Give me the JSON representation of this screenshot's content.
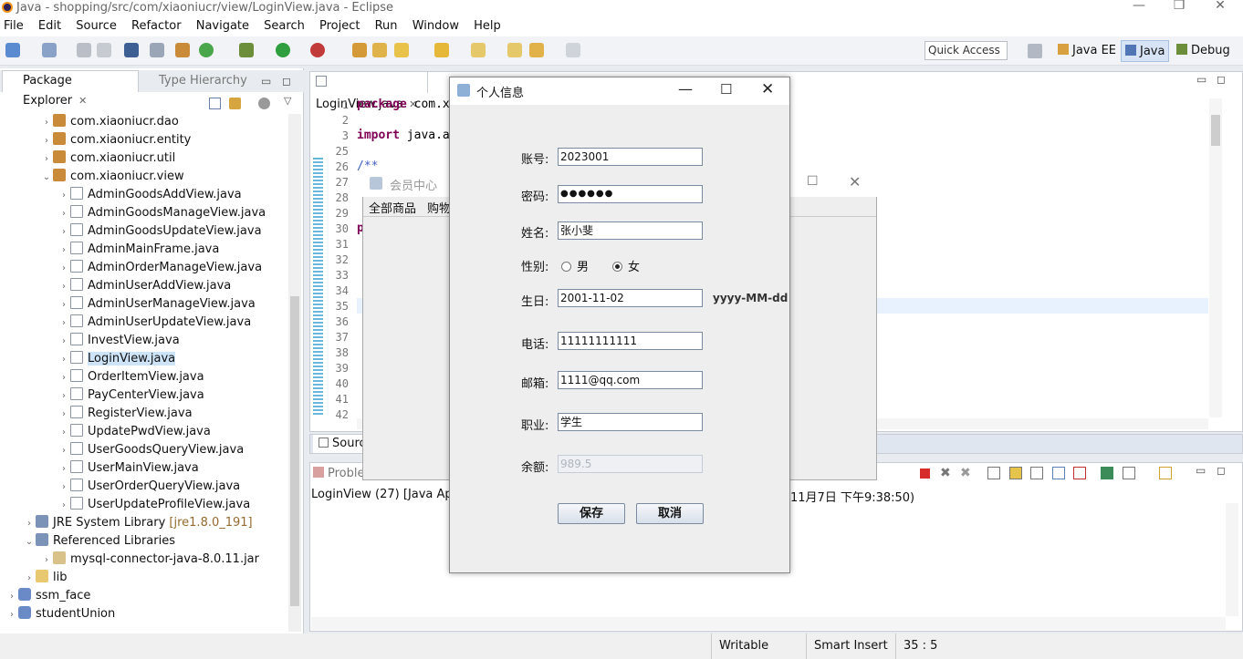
{
  "window": {
    "title": "Java - shopping/src/com/xiaoniucr/view/LoginView.java - Eclipse"
  },
  "menu": [
    "File",
    "Edit",
    "Source",
    "Refactor",
    "Navigate",
    "Search",
    "Project",
    "Run",
    "Window",
    "Help"
  ],
  "quick_access": "Quick Access",
  "perspectives": [
    "Java EE",
    "Java",
    "Debug"
  ],
  "package_explorer": {
    "tab_label": "Package Explorer",
    "tab2_label": "Type Hierarchy",
    "rows": [
      {
        "label": "com.xiaoniucr.dao",
        "extra": ""
      },
      {
        "label": "com.xiaoniucr.entity",
        "extra": ""
      },
      {
        "label": "com.xiaoniucr.util",
        "extra": ""
      },
      {
        "label": "com.xiaoniucr.view",
        "extra": ""
      },
      {
        "label": "AdminGoodsAddView.java",
        "extra": ""
      },
      {
        "label": "AdminGoodsManageView.java",
        "extra": ""
      },
      {
        "label": "AdminGoodsUpdateView.java",
        "extra": ""
      },
      {
        "label": "AdminMainFrame.java",
        "extra": ""
      },
      {
        "label": "AdminOrderManageView.java",
        "extra": ""
      },
      {
        "label": "AdminUserAddView.java",
        "extra": ""
      },
      {
        "label": "AdminUserManageView.java",
        "extra": ""
      },
      {
        "label": "AdminUserUpdateView.java",
        "extra": ""
      },
      {
        "label": "InvestView.java",
        "extra": ""
      },
      {
        "label": "LoginView.java",
        "extra": ""
      },
      {
        "label": "OrderItemView.java",
        "extra": ""
      },
      {
        "label": "PayCenterView.java",
        "extra": ""
      },
      {
        "label": "RegisterView.java",
        "extra": ""
      },
      {
        "label": "UpdatePwdView.java",
        "extra": ""
      },
      {
        "label": "UserGoodsQueryView.java",
        "extra": ""
      },
      {
        "label": "UserMainView.java",
        "extra": ""
      },
      {
        "label": "UserOrderQueryView.java",
        "extra": ""
      },
      {
        "label": "UserUpdateProfileView.java",
        "extra": ""
      },
      {
        "label": "JRE System Library",
        "extra": "[jre1.8.0_191]"
      },
      {
        "label": "Referenced Libraries",
        "extra": ""
      },
      {
        "label": "mysql-connector-java-8.0.11.jar",
        "extra": ""
      },
      {
        "label": "lib",
        "extra": ""
      },
      {
        "label": "ssm_face",
        "extra": ""
      },
      {
        "label": "studentUnion",
        "extra": ""
      }
    ]
  },
  "editor": {
    "tab_label": "LoginView.java",
    "line_numbers": [
      "1",
      "2",
      "3",
      "25",
      "26",
      "27",
      "28",
      "29",
      "30",
      "31",
      "32",
      "33",
      "34",
      "35",
      "36",
      "37",
      "38",
      "39",
      "40",
      "41",
      "42"
    ],
    "code_line1_kw": "package",
    "code_line1_rest": "com.x",
    "code_line3_kw": "import",
    "code_line3_rest": "java.a",
    "code_line26": "/**",
    "code_line30": "p",
    "source_tab": "Sourc"
  },
  "console": {
    "tab_label": "Proble",
    "line_left": "LoginView (27) [Java Appli",
    "line_right": "11月7日 下午9:38:50)"
  },
  "status": {
    "writable": "Writable",
    "insert": "Smart Insert",
    "position": "35 : 5"
  },
  "member_window": {
    "title": "会员中心",
    "menu1": "全部商品",
    "menu2": "购物"
  },
  "dialog": {
    "title": "个人信息",
    "account_label": "账号:",
    "account_value": "2023001",
    "password_label": "密码:",
    "password_value": "●●●●●●",
    "name_label": "姓名:",
    "name_value": "张小斐",
    "gender_label": "性别:",
    "gender_male": "男",
    "gender_female": "女",
    "birthday_label": "生日:",
    "birthday_value": "2001-11-02",
    "birthday_hint": "yyyy-MM-dd",
    "phone_label": "电话:",
    "phone_value": "11111111111",
    "email_label": "邮箱:",
    "email_value": "1111@qq.com",
    "job_label": "职业:",
    "job_value": "学生",
    "balance_label": "余额:",
    "balance_value": "989.5",
    "save_label": "保存",
    "cancel_label": "取消"
  }
}
